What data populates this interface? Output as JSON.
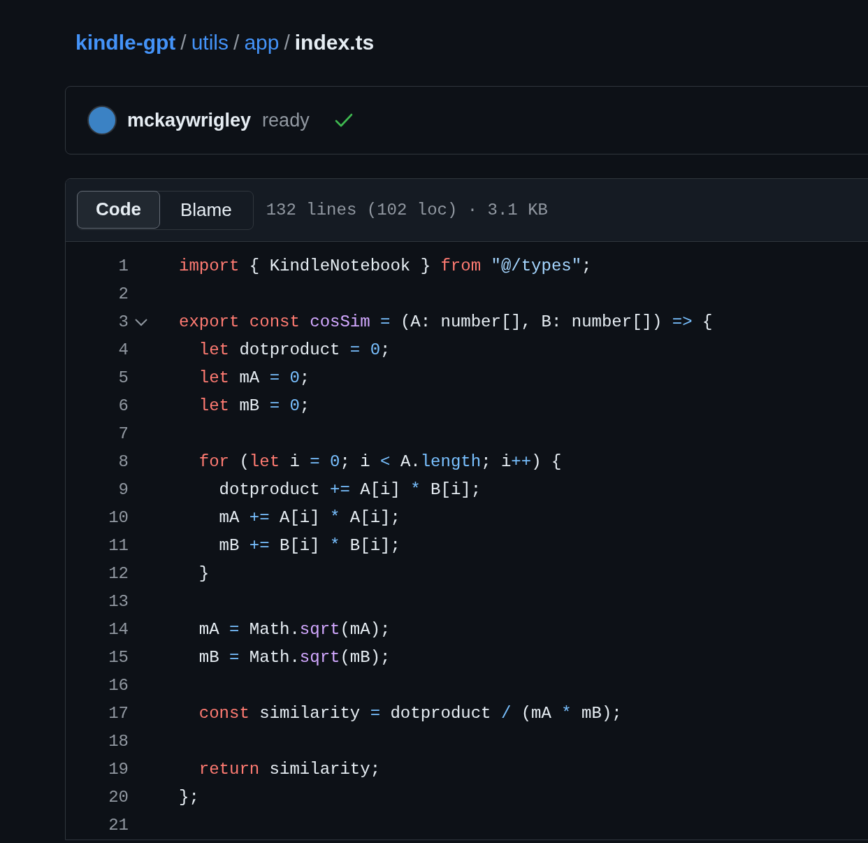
{
  "breadcrumb": [
    {
      "kind": "repo",
      "text": "kindle-gpt"
    },
    {
      "kind": "separator",
      "text": "/"
    },
    {
      "kind": "link",
      "text": "utils"
    },
    {
      "kind": "separator",
      "text": "/"
    },
    {
      "kind": "link",
      "text": "app"
    },
    {
      "kind": "separator",
      "text": "/"
    },
    {
      "kind": "current",
      "text": "index.ts"
    }
  ],
  "commit": {
    "author": "mckaywrigley",
    "message": "ready",
    "checks_passed": true
  },
  "file_header": {
    "tabs": [
      {
        "label": "Code",
        "selected": true
      },
      {
        "label": "Blame",
        "selected": false
      }
    ],
    "info": "132 lines (102 loc) · 3.1 KB"
  },
  "code_lines": [
    {
      "number": "1",
      "foldable": false,
      "tokens": [
        {
          "kind": "keyword",
          "text": "import"
        },
        {
          "kind": "plain",
          "text": " { KindleNotebook } "
        },
        {
          "kind": "keyword",
          "text": "from"
        },
        {
          "kind": "string",
          "text": " \"@/types\""
        },
        {
          "kind": "plain",
          "text": ";"
        }
      ]
    },
    {
      "number": "2",
      "foldable": false
    },
    {
      "number": "3",
      "foldable": true,
      "tokens": [
        {
          "kind": "keyword",
          "text": "export"
        },
        {
          "kind": "keyword",
          "text": " const"
        },
        {
          "kind": "function",
          "text": " cosSim"
        },
        {
          "kind": "operator",
          "text": " ="
        },
        {
          "kind": "plain",
          "text": " (A: number[], B: number[]) "
        },
        {
          "kind": "operator",
          "text": "=>"
        },
        {
          "kind": "plain",
          "text": " {"
        }
      ]
    },
    {
      "number": "4",
      "foldable": false,
      "tokens": [
        {
          "kind": "keyword",
          "text": "  let"
        },
        {
          "kind": "plain",
          "text": " dotproduct "
        },
        {
          "kind": "operator",
          "text": "="
        },
        {
          "kind": "number",
          "text": " 0"
        },
        {
          "kind": "plain",
          "text": ";"
        }
      ]
    },
    {
      "number": "5",
      "foldable": false,
      "tokens": [
        {
          "kind": "keyword",
          "text": "  let"
        },
        {
          "kind": "plain",
          "text": " mA "
        },
        {
          "kind": "operator",
          "text": "="
        },
        {
          "kind": "number",
          "text": " 0"
        },
        {
          "kind": "plain",
          "text": ";"
        }
      ]
    },
    {
      "number": "6",
      "foldable": false,
      "tokens": [
        {
          "kind": "keyword",
          "text": "  let"
        },
        {
          "kind": "plain",
          "text": " mB "
        },
        {
          "kind": "operator",
          "text": "="
        },
        {
          "kind": "number",
          "text": " 0"
        },
        {
          "kind": "plain",
          "text": ";"
        }
      ]
    },
    {
      "number": "7",
      "foldable": false
    },
    {
      "number": "8",
      "foldable": false,
      "tokens": [
        {
          "kind": "keyword",
          "text": "  for"
        },
        {
          "kind": "plain",
          "text": " ("
        },
        {
          "kind": "keyword",
          "text": "let"
        },
        {
          "kind": "plain",
          "text": " i "
        },
        {
          "kind": "operator",
          "text": "="
        },
        {
          "kind": "number",
          "text": " 0"
        },
        {
          "kind": "plain",
          "text": "; i "
        },
        {
          "kind": "operator",
          "text": "<"
        },
        {
          "kind": "plain",
          "text": " A."
        },
        {
          "kind": "property",
          "text": "length"
        },
        {
          "kind": "plain",
          "text": "; i"
        },
        {
          "kind": "operator",
          "text": "++"
        },
        {
          "kind": "plain",
          "text": ") {"
        }
      ]
    },
    {
      "number": "9",
      "foldable": false,
      "tokens": [
        {
          "kind": "plain",
          "text": "    dotproduct "
        },
        {
          "kind": "operator",
          "text": "+="
        },
        {
          "kind": "plain",
          "text": " A[i] "
        },
        {
          "kind": "operator",
          "text": "*"
        },
        {
          "kind": "plain",
          "text": " B[i];"
        }
      ]
    },
    {
      "number": "10",
      "foldable": false,
      "tokens": [
        {
          "kind": "plain",
          "text": "    mA "
        },
        {
          "kind": "operator",
          "text": "+="
        },
        {
          "kind": "plain",
          "text": " A[i] "
        },
        {
          "kind": "operator",
          "text": "*"
        },
        {
          "kind": "plain",
          "text": " A[i];"
        }
      ]
    },
    {
      "number": "11",
      "foldable": false,
      "tokens": [
        {
          "kind": "plain",
          "text": "    mB "
        },
        {
          "kind": "operator",
          "text": "+="
        },
        {
          "kind": "plain",
          "text": " B[i] "
        },
        {
          "kind": "operator",
          "text": "*"
        },
        {
          "kind": "plain",
          "text": " B[i];"
        }
      ]
    },
    {
      "number": "12",
      "foldable": false,
      "tokens": [
        {
          "kind": "plain",
          "text": "  }"
        }
      ]
    },
    {
      "number": "13",
      "foldable": false
    },
    {
      "number": "14",
      "foldable": false,
      "tokens": [
        {
          "kind": "plain",
          "text": "  mA "
        },
        {
          "kind": "operator",
          "text": "="
        },
        {
          "kind": "plain",
          "text": " Math."
        },
        {
          "kind": "function",
          "text": "sqrt"
        },
        {
          "kind": "plain",
          "text": "(mA);"
        }
      ]
    },
    {
      "number": "15",
      "foldable": false,
      "tokens": [
        {
          "kind": "plain",
          "text": "  mB "
        },
        {
          "kind": "operator",
          "text": "="
        },
        {
          "kind": "plain",
          "text": " Math."
        },
        {
          "kind": "function",
          "text": "sqrt"
        },
        {
          "kind": "plain",
          "text": "(mB);"
        }
      ]
    },
    {
      "number": "16",
      "foldable": false
    },
    {
      "number": "17",
      "foldable": false,
      "tokens": [
        {
          "kind": "keyword",
          "text": "  const"
        },
        {
          "kind": "plain",
          "text": " similarity "
        },
        {
          "kind": "operator",
          "text": "="
        },
        {
          "kind": "plain",
          "text": " dotproduct "
        },
        {
          "kind": "operator",
          "text": "/"
        },
        {
          "kind": "plain",
          "text": " (mA "
        },
        {
          "kind": "operator",
          "text": "*"
        },
        {
          "kind": "plain",
          "text": " mB);"
        }
      ]
    },
    {
      "number": "18",
      "foldable": false
    },
    {
      "number": "19",
      "foldable": false,
      "tokens": [
        {
          "kind": "keyword",
          "text": "  return"
        },
        {
          "kind": "plain",
          "text": " similarity;"
        }
      ]
    },
    {
      "number": "20",
      "foldable": false,
      "tokens": [
        {
          "kind": "plain",
          "text": "};"
        }
      ]
    },
    {
      "number": "21",
      "foldable": false
    }
  ]
}
